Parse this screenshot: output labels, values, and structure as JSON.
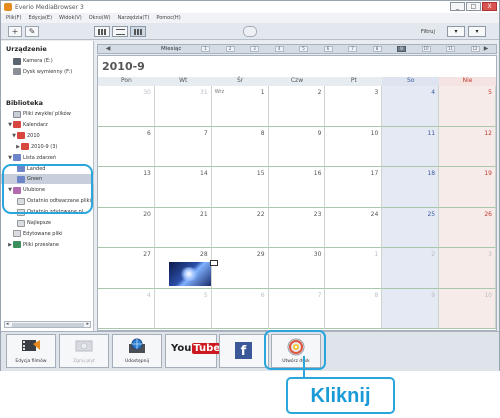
{
  "window": {
    "title": "Everio MediaBrowser 3",
    "controls": [
      "_",
      "□",
      "X"
    ]
  },
  "menu": [
    "Plik(F)",
    "Edycja(E)",
    "Widok(V)",
    "Okno(W)",
    "Narzędzia(T)",
    "Pomoc(H)"
  ],
  "toolbar": {
    "add_label": "+",
    "tools_label": "✎",
    "filter_label": "Filtruj",
    "filter_btn1": "▾",
    "filter_btn2": "▾"
  },
  "sidebar": {
    "devices_heading": "Urządzenie",
    "devices": [
      {
        "label": "Kamera (E:)",
        "icon": "camera-icon"
      },
      {
        "label": "Dysk wymienny (F:)",
        "icon": "disk-icon"
      }
    ],
    "library_heading": "Biblioteka",
    "library": [
      {
        "label": "Pliki zwykłe/ plików",
        "icon": "library-icon",
        "indent": 1,
        "arrow": ""
      },
      {
        "label": "Kalendarz",
        "icon": "calendar-icon",
        "indent": 1,
        "arrow": "▼"
      },
      {
        "label": "2010",
        "icon": "calendar-icon",
        "indent": 2,
        "arrow": "▼"
      },
      {
        "label": "2010-9 (3)",
        "icon": "calendar-icon",
        "indent": 3,
        "arrow": "▶"
      },
      {
        "label": "Lista zdarzeń",
        "icon": "event-icon",
        "indent": 1,
        "arrow": "▼"
      },
      {
        "label": "Landed",
        "icon": "event-icon",
        "indent": 2,
        "arrow": ""
      },
      {
        "label": "Green",
        "icon": "event-icon",
        "indent": 2,
        "arrow": ""
      },
      {
        "label": "Ulubione",
        "icon": "favorites-icon",
        "indent": 1,
        "arrow": "▼"
      },
      {
        "label": "Ostatnio odtwarzane pliki",
        "icon": "document-icon",
        "indent": 2,
        "arrow": ""
      },
      {
        "label": "Ostatnio zdytowane pl",
        "icon": "document-icon",
        "indent": 2,
        "arrow": ""
      },
      {
        "label": "Najlepsze",
        "icon": "document-icon",
        "indent": 2,
        "arrow": ""
      },
      {
        "label": "Edytowane pliki",
        "icon": "document-icon",
        "indent": 1,
        "arrow": ""
      },
      {
        "label": "Pliki przesłane",
        "icon": "image-icon",
        "indent": 1,
        "arrow": "▶"
      }
    ],
    "scroll_left": "◂",
    "scroll_right": "▸"
  },
  "calendar": {
    "nav_prev": "◀",
    "nav_next": "▶",
    "month_label": "Miesiąc",
    "months": [
      "1",
      "2",
      "3",
      "4",
      "5",
      "6",
      "7",
      "8",
      "9",
      "10",
      "11",
      "12"
    ],
    "active_month": "9",
    "title": "2010-9",
    "weekdays": [
      "Pon",
      "Wt",
      "Śr",
      "Czw",
      "Pt",
      "So",
      "Nie"
    ],
    "weeks": [
      [
        "30",
        "31",
        "1",
        "2",
        "3",
        "4",
        "5"
      ],
      [
        "6",
        "7",
        "8",
        "9",
        "10",
        "11",
        "12"
      ],
      [
        "13",
        "14",
        "15",
        "16",
        "17",
        "18",
        "19"
      ],
      [
        "20",
        "21",
        "22",
        "23",
        "24",
        "25",
        "26"
      ],
      [
        "27",
        "28",
        "29",
        "30",
        "1",
        "2",
        "3"
      ],
      [
        "4",
        "5",
        "6",
        "7",
        "8",
        "9",
        "10"
      ]
    ],
    "first_cell_month_label": "Wrz"
  },
  "bottom_buttons": [
    {
      "label": "Edycja filmów",
      "enabled": true
    },
    {
      "label": "Zgraj płyt",
      "enabled": false
    },
    {
      "label": "Udostępnij",
      "enabled": true
    },
    {
      "label": "",
      "enabled": true
    },
    {
      "label": "",
      "enabled": true
    },
    {
      "label": "Utwórz dysk",
      "enabled": true
    }
  ],
  "youtube": {
    "you": "You",
    "tube": "Tube"
  },
  "facebook": {
    "letter": "f"
  },
  "callout": {
    "text": "Kliknij"
  },
  "colors": {
    "accent": "#2aa6dd",
    "sunday": "#c0392b",
    "saturday": "#3a5a9a"
  }
}
